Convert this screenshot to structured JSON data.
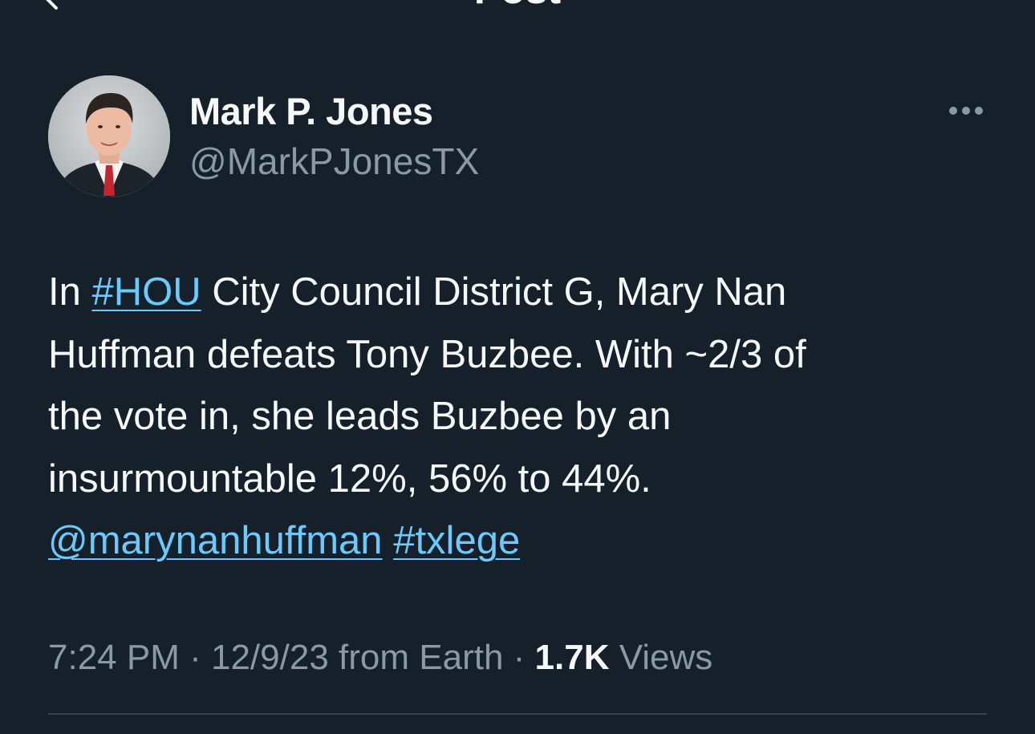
{
  "header": {
    "title": "Post",
    "back_icon": "chevron-left-icon"
  },
  "author": {
    "name": "Mark P. Jones",
    "handle": "@MarkPJonesTX",
    "more_icon": "ellipsis-horizontal-icon"
  },
  "tweet": {
    "segments": {
      "intro": "In ",
      "hashtag_hou": "#HOU",
      "line1_rest": " City Council District G, Mary Nan",
      "line2": "Huffman defeats Tony Buzbee. With ~2/3 of",
      "line3": "the vote in, she leads Buzbee by an",
      "line4": "insurmountable 12%, 56% to 44%.",
      "mention": "@marynanhuffman",
      "space": " ",
      "hashtag_txlege": "#txlege"
    }
  },
  "meta": {
    "time": "7:24 PM",
    "sep1": " · ",
    "date": "12/9/23",
    "source": " from Earth",
    "sep2": " · ",
    "views_count": "1.7K",
    "views_label": " Views"
  },
  "colors": {
    "background": "#15202b",
    "text": "#f7f9f9",
    "secondary": "#8b98a5",
    "link": "#6bc9fb",
    "divider": "#38444d"
  }
}
